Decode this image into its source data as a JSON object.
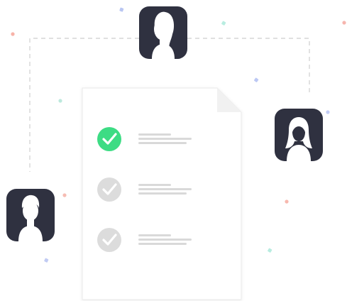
{
  "illustration": {
    "checklist": {
      "items": [
        {
          "checked": true
        },
        {
          "checked": false
        },
        {
          "checked": false
        }
      ]
    },
    "avatars": [
      {
        "icon": "user-female-long-hair-icon"
      },
      {
        "icon": "user-female-bob-hair-icon"
      },
      {
        "icon": "user-male-icon"
      }
    ]
  },
  "colors": {
    "accent_check": "#3ddc84",
    "inactive_check": "#dcdcdc",
    "avatar_bg": "#2f3140",
    "avatar_fg": "#ffffff",
    "document_bg": "#ffffff",
    "document_border": "#ececec",
    "placeholder_line": "#d9d9d9",
    "connector_line": "#d6d6d6"
  }
}
